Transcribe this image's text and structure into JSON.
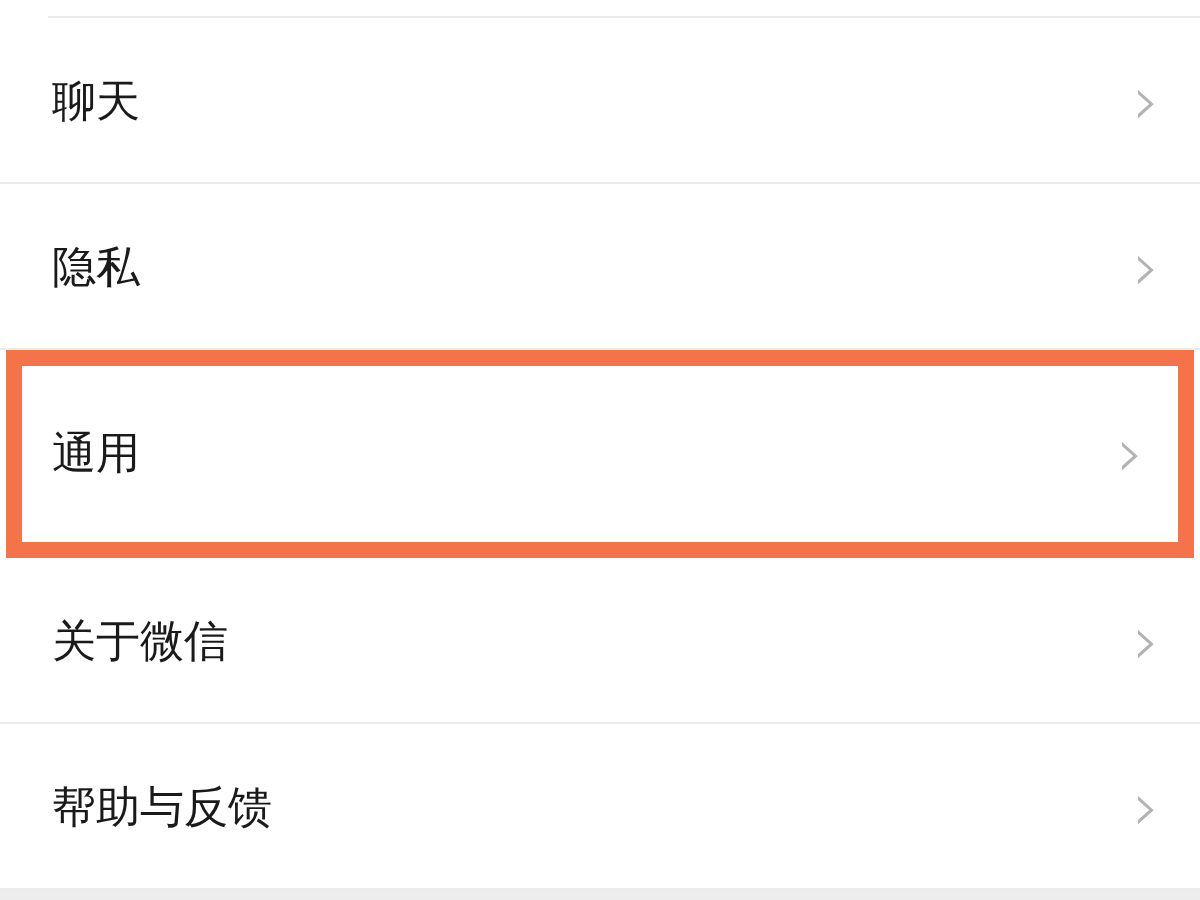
{
  "settings": [
    {
      "label": "聊天",
      "chevron": "›",
      "highlighted": false
    },
    {
      "label": "隐私",
      "chevron": "›",
      "highlighted": false
    },
    {
      "label": "通用",
      "chevron": "›",
      "highlighted": true
    },
    {
      "label": "关于微信",
      "chevron": "›",
      "highlighted": false
    },
    {
      "label": "帮助与反馈",
      "chevron": "›",
      "highlighted": false
    }
  ]
}
